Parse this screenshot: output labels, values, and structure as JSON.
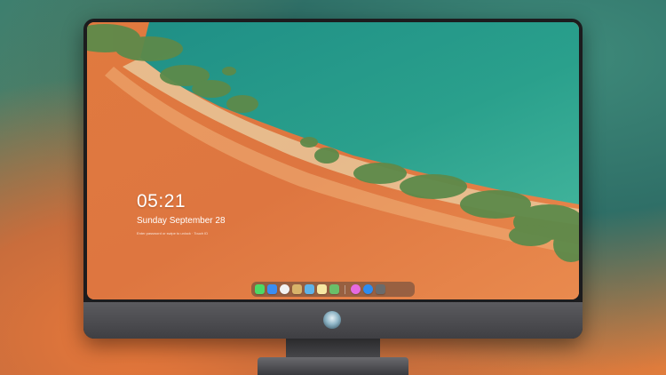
{
  "lock_screen": {
    "time": "05:21",
    "date": "Sunday September  28",
    "hint": "Enter password or swipe to unlock · Touch ID"
  },
  "dock": {
    "apps": [
      {
        "name": "messages-icon",
        "color": "#4cd964"
      },
      {
        "name": "finder-icon",
        "color": "#3b8df1"
      },
      {
        "name": "clock-icon",
        "color": "#f2f2f2"
      },
      {
        "name": "preview-icon",
        "color": "#d8b36a"
      },
      {
        "name": "clapper-icon",
        "color": "#5fb3e8"
      },
      {
        "name": "notes-icon",
        "color": "#f6e7a2"
      },
      {
        "name": "photos-icon",
        "color": "#6abf69"
      }
    ],
    "apps_right": [
      {
        "name": "itunes-icon",
        "color": "#e66ae0"
      },
      {
        "name": "app-store-icon",
        "color": "#2d8cf0"
      },
      {
        "name": "camera-icon",
        "color": "#6b6b6b"
      }
    ]
  }
}
